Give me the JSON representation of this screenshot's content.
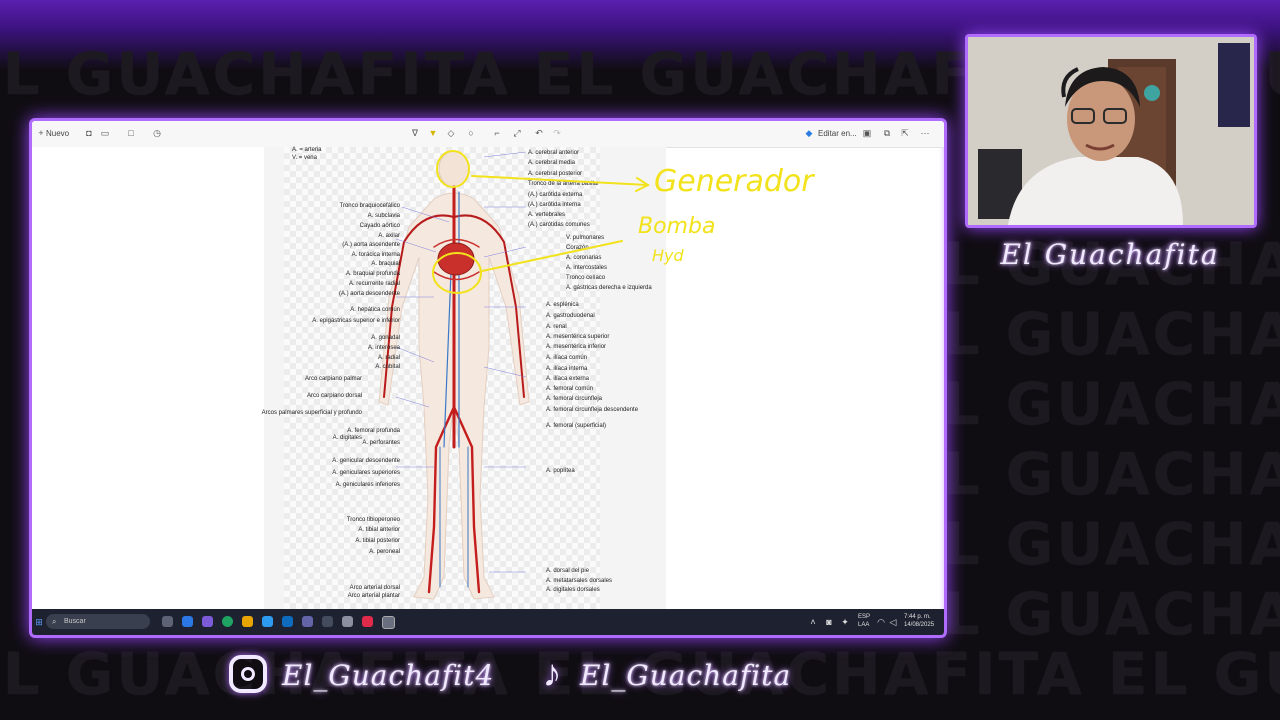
{
  "watermark": "EL GUACHAFITA EL GUACHAFITA EL GUACHAFITA",
  "editor": {
    "toolbar": {
      "new_label": "Nuevo",
      "edit_label": "Editar en..."
    },
    "diagram": {
      "legend_artery": "A. = arteria",
      "legend_vein": "V. = vena",
      "labels_left": [
        "Tronco braquiocefálico",
        "A. subclavia",
        "Cayado aórtico",
        "A. axilar",
        "(A.) aorta ascendente",
        "A. torácica interna",
        "A. braquial",
        "A. braquial profunda",
        "A. recurrente radial",
        "(A.) aorta descendente",
        "A. hepática común",
        "A. epigástricas superior e inferior",
        "A. gonadal",
        "A. interósea",
        "A. radial",
        "A. cubital",
        "Arco carpiano palmar",
        "Arco carpiano dorsal",
        "Arcos palmares superficial y profundo",
        "A. digitales",
        "A. femoral profunda",
        "A. perforantes",
        "A. genicular descendente",
        "A. geniculares superiores",
        "A. geniculares inferiores",
        "Tronco tibioperoneo",
        "A. tibial anterior",
        "A. tibial posterior",
        "A. peroneal",
        "Arco arterial dorsal",
        "Arco arterial plantar"
      ],
      "labels_right": [
        "A. cerebral anterior",
        "A. cerebral media",
        "A. cerebral posterior",
        "Tronco de la arteria basilar",
        "(A.) carótida externa",
        "(A.) carótida interna",
        "A. vertebrales",
        "(A.) carótidas comunes",
        "V. pulmonares",
        "Corazón",
        "A. coronarias",
        "A. intercostales",
        "Tronco celíaco",
        "A. gástricas derecha e izquierda",
        "A. esplénica",
        "A. gastroduodenal",
        "A. renal",
        "A. mesentérica superior",
        "A. mesentérica inferior",
        "A. ilíaca común",
        "A. ilíaca interna",
        "A. ilíaca externa",
        "A. femoral común",
        "A. femoral circunfleja",
        "A. femoral circunfleja descendente",
        "A. femoral (superficial)",
        "A. poplítea",
        "A. dorsal del pie",
        "A. metatarsales dorsales",
        "A. digitales dorsales"
      ]
    },
    "annotations": {
      "generator": "Generador",
      "pump": "Bomba",
      "hyd": "Hyd"
    }
  },
  "taskbar": {
    "search_placeholder": "Buscar",
    "lang": "ESP",
    "lang_sub": "LAA",
    "time": "7:44 p. m.",
    "date": "14/08/2025"
  },
  "overlay": {
    "channel_name": "El Guachafita",
    "instagram_handle": "El_Guachafit4",
    "tiktok_handle": "El_Guachafita",
    "accent": "#b06cff",
    "annotation_color": "#f2e21b"
  }
}
